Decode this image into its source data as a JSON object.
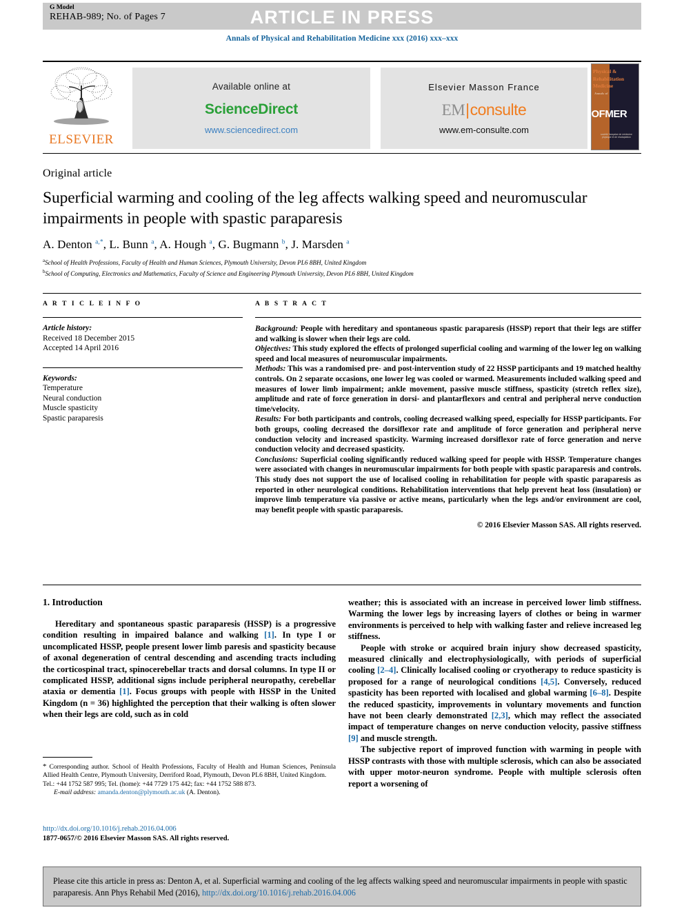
{
  "header": {
    "g_model": "G Model",
    "run_head": "REHAB-989; No. of Pages 7",
    "article_in_press": "ARTICLE IN PRESS",
    "journal_line": "Annals of Physical and Rehabilitation Medicine xxx (2016) xxx–xxx"
  },
  "masthead": {
    "elsevier_wordmark": "ELSEVIER",
    "available_online": "Available online at",
    "sciencedirect": "ScienceDirect",
    "sciencedirect_url": "www.sciencedirect.com",
    "elsevier_masson": "Elsevier Masson France",
    "em_em": "EM",
    "em_bar": "|",
    "em_consulte": "consulte",
    "em_url": "www.em-consulte.com",
    "sofmer": {
      "annals_of": "Annals of",
      "title_line1": "Physical &",
      "title_line2": "Rehabilitation",
      "title_line3": "Medicine",
      "logo": "SOFMER",
      "sub": "société française de médecine physique et de réadaptation"
    }
  },
  "article": {
    "kicker": "Original article",
    "title": "Superficial warming and cooling of the leg affects walking speed and neuromuscular impairments in people with spastic paraparesis",
    "authors_html": "A. Denton <sup>a,*</sup>, L. Bunn <sup>a</sup>, A. Hough <sup>a</sup>, G. Bugmann <sup>b</sup>, J. Marsden <sup>a</sup>",
    "affiliation_a": "School of Health Professions, Faculty of Health and Human Sciences, Plymouth University, Devon PL6 8BH, United Kingdom",
    "affiliation_b": "School of Computing, Electronics and Mathematics, Faculty of Science and Engineering Plymouth University, Devon PL6 8BH, United Kingdom",
    "affil_marker_a": "a",
    "affil_marker_b": "b"
  },
  "info": {
    "heading": "A R T I C L E   I N F O",
    "history_label": "Article history:",
    "received": "Received 18 December 2015",
    "accepted": "Accepted 14 April 2016",
    "keywords_label": "Keywords:",
    "keywords": [
      "Temperature",
      "Neural conduction",
      "Muscle spasticity",
      "Spastic paraparesis"
    ]
  },
  "abstract": {
    "heading": "A B S T R A C T",
    "sections": [
      {
        "label": "Background:",
        "text": " People with hereditary and spontaneous spastic paraparesis (HSSP) report that their legs are stiffer and walking is slower when their legs are cold."
      },
      {
        "label": "Objectives:",
        "text": " This study explored the effects of prolonged superficial cooling and warming of the lower leg on walking speed and local measures of neuromuscular impairments."
      },
      {
        "label": "Methods:",
        "text": " This was a randomised pre- and post-intervention study of 22 HSSP participants and 19 matched healthy controls. On 2 separate occasions, one lower leg was cooled or warmed. Measurements included walking speed and measures of lower limb impairment; ankle movement, passive muscle stiffness, spasticity (stretch reflex size), amplitude and rate of force generation in dorsi- and plantarflexors and central and peripheral nerve conduction time/velocity."
      },
      {
        "label": "Results:",
        "text": " For both participants and controls, cooling decreased walking speed, especially for HSSP participants. For both groups, cooling decreased the dorsiflexor rate and amplitude of force generation and peripheral nerve conduction velocity and increased spasticity. Warming increased dorsiflexor rate of force generation and nerve conduction velocity and decreased spasticity."
      },
      {
        "label": "Conclusions:",
        "text": " Superficial cooling significantly reduced walking speed for people with HSSP. Temperature changes were associated with changes in neuromuscular impairments for both people with spastic paraparesis and controls. This study does not support the use of localised cooling in rehabilitation for people with spastic paraparesis as reported in other neurological conditions. Rehabilitation interventions that help prevent heat loss (insulation) or improve limb temperature via passive or active means, particularly when the legs and/or environment are cool, may benefit people with spastic paraparesis."
      }
    ],
    "copyright": "© 2016 Elsevier Masson SAS. All rights reserved."
  },
  "body": {
    "intro_heading": "1. Introduction",
    "left_paragraphs": [
      "Hereditary and spontaneous spastic paraparesis (HSSP) is a progressive condition resulting in impaired balance and walking [1]. In type I or uncomplicated HSSP, people present lower limb paresis and spasticity because of axonal degeneration of central descending and ascending tracts including the corticospinal tract, spinocerebellar tracts and dorsal columns. In type II or complicated HSSP, additional signs include peripheral neuropathy, cerebellar ataxia or dementia [1]. Focus groups with people with HSSP in the United Kingdom (n = 36) highlighted the perception that their walking is often slower when their legs are cold, such as in cold"
    ],
    "right_paragraphs": [
      "weather; this is associated with an increase in perceived lower limb stiffness. Warming the lower legs by increasing layers of clothes or being in warmer environments is perceived to help with walking faster and relieve increased leg stiffness.",
      "People with stroke or acquired brain injury show decreased spasticity, measured clinically and electrophysiologically, with periods of superficial cooling [2–4]. Clinically localised cooling or cryotherapy to reduce spasticity is proposed for a range of neurological conditions [4,5]. Conversely, reduced spasticity has been reported with localised and global warming [6–8]. Despite the reduced spasticity, improvements in voluntary movements and function have not been clearly demonstrated [2,3], which may reflect the associated impact of temperature changes on nerve conduction velocity, passive stiffness [9] and muscle strength.",
      "The subjective report of improved function with warming in people with HSSP contrasts with those with multiple sclerosis, which can also be associated with upper motor-neuron syndrome. People with multiple sclerosis often report a worsening of"
    ]
  },
  "footnote": {
    "star": "*",
    "corresponding": " Corresponding author. School of Health Professions, Faculty of Health and Human Sciences, Peninsula Allied Health Centre, Plymouth University, Derriford Road, Plymouth, Devon PL6 8BH, United Kingdom.",
    "tel": "Tel.: +44 1752 587 995; Tel. (home): +44 7729 175 442; fax: +44 1752 588 873.",
    "email_label": "E-mail address:",
    "email": "amanda.denton@plymouth.ac.uk",
    "email_suffix": " (A. Denton).",
    "doi": "http://dx.doi.org/10.1016/j.rehab.2016.04.006",
    "issn": "1877-0657/© 2016 Elsevier Masson SAS. All rights reserved."
  },
  "citation": {
    "text_before": "Please cite this article in press as: Denton A, et al. Superficial warming and cooling of the leg affects walking speed and neuromuscular impairments in people with spastic paraparesis. Ann Phys Rehabil Med (2016), ",
    "doi": "http://dx.doi.org/10.1016/j.rehab.2016.04.006"
  },
  "colors": {
    "journal_blue": "#14639b",
    "link_blue": "#1a6aa8",
    "sciencedirect_green": "#2aa038",
    "elsevier_orange": "#E87722",
    "em_orange": "#f07c1e",
    "grey_bar": "#c9c9c9",
    "panel_grey": "#e3e3e3"
  }
}
